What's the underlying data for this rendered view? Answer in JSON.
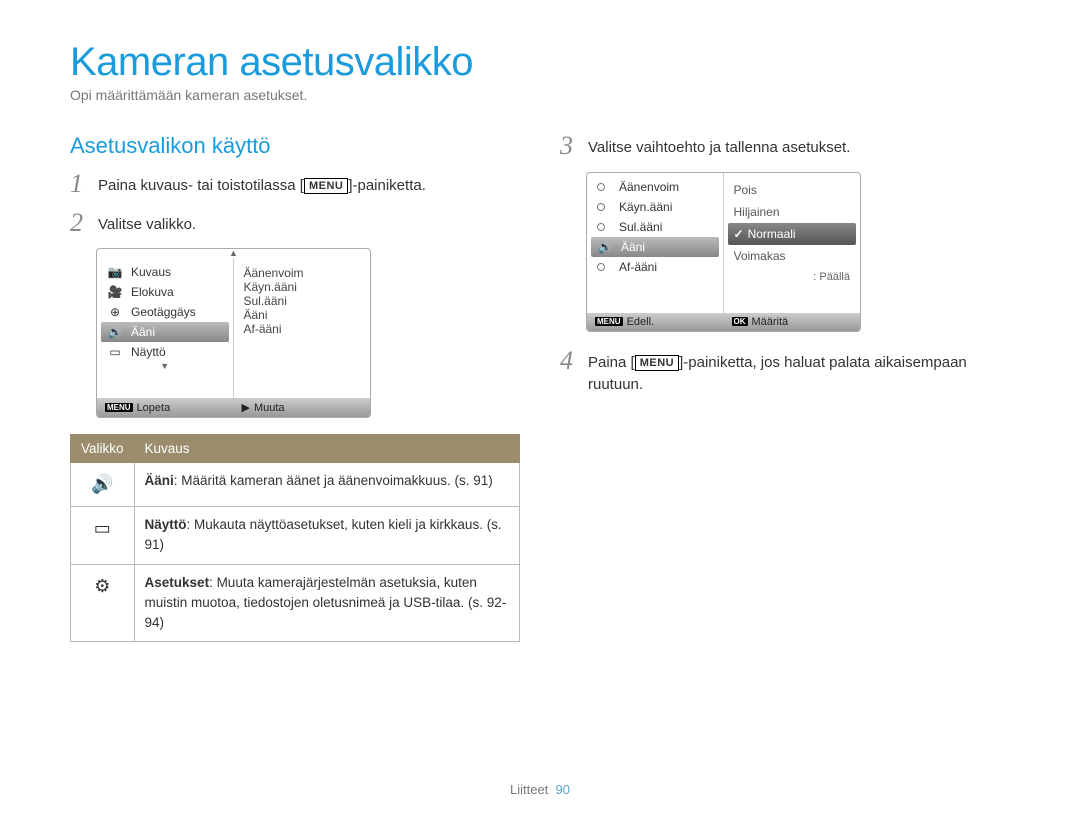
{
  "page_title": "Kameran asetusvalikko",
  "page_subtitle": "Opi määrittämään kameran asetukset.",
  "section_heading": "Asetusvalikon käyttö",
  "menu_label": "MENU",
  "steps": {
    "s1_pre": "Paina kuvaus- tai toistotilassa [",
    "s1_post": "]-painiketta.",
    "s2": "Valitse valikko.",
    "s3": "Valitse vaihtoehto ja tallenna asetukset.",
    "s4_pre": "Paina [",
    "s4_post": "]-painiketta, jos haluat palata aikaisempaan ruutuun."
  },
  "lcd1": {
    "left_items": [
      "Kuvaus",
      "Elokuva",
      "Geotäggäys",
      "Ääni",
      "Näyttö"
    ],
    "left_selected_index": 3,
    "right_items": [
      "Äänenvoim",
      "Käyn.ääni",
      "Sul.ääni",
      "Ääni",
      "Af-ääni"
    ],
    "foot_left": "Lopeta",
    "foot_right": "Muuta",
    "foot_arrow": "▶"
  },
  "lcd2": {
    "left_items": [
      "Äänenvoim",
      "Käyn.ääni",
      "Sul.ääni",
      "Ääni",
      "Af-ääni"
    ],
    "left_selected_index": 3,
    "right_options": [
      "Pois",
      "Hiljainen",
      "Normaali",
      "Voimakas"
    ],
    "right_selected_index": 2,
    "status": ": Päällä",
    "foot_left": "Edell.",
    "foot_right": "Määritä",
    "ok_label": "OK"
  },
  "table": {
    "head_menu": "Valikko",
    "head_desc": "Kuvaus",
    "rows": [
      {
        "icon": "🔊",
        "name": "Ääni",
        "text": ": Määritä kameran äänet ja äänenvoimakkuus. (s. 91)"
      },
      {
        "icon": "▭",
        "name": "Näyttö",
        "text": ": Mukauta näyttöasetukset, kuten kieli ja kirkkaus. (s. 91)"
      },
      {
        "icon": "⚙",
        "name": "Asetukset",
        "text": ": Muuta kamerajärjestelmän asetuksia, kuten muistin muotoa, tiedostojen oletusnimeä ja USB-tilaa. (s. 92-94)"
      }
    ]
  },
  "footer": {
    "label": "Liitteet",
    "page": "90"
  }
}
